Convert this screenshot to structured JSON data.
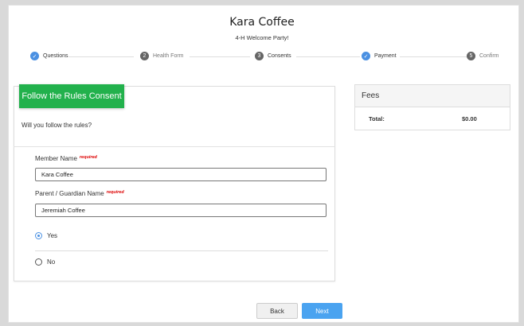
{
  "header": {
    "title": "Kara Coffee",
    "subtitle": "4-H Welcome Party!"
  },
  "steps": [
    {
      "label": "Questions",
      "state": "done",
      "marker": "✓"
    },
    {
      "label": "Health Form",
      "state": "num",
      "marker": "2"
    },
    {
      "label": "Consents",
      "state": "num",
      "marker": "3"
    },
    {
      "label": "Payment",
      "state": "done",
      "marker": "✓"
    },
    {
      "label": "Confirm",
      "state": "num",
      "marker": "5"
    }
  ],
  "consent": {
    "tab_label": "Follow the Rules Consent",
    "question": "Will you follow the rules?",
    "member_label": "Member Name",
    "member_required": "required",
    "member_value": "Kara Coffee",
    "guardian_label": "Parent / Guardian Name",
    "guardian_required": "required",
    "guardian_value": "Jeremiah Coffee",
    "option_yes": "Yes",
    "option_no": "No",
    "selected": "Yes"
  },
  "fees": {
    "heading": "Fees",
    "total_label": "Total:",
    "total_value": "$0.00"
  },
  "buttons": {
    "back": "Back",
    "next": "Next"
  },
  "colors": {
    "accent": "#4a90e2",
    "green": "#22b14c",
    "required": "#dd0000"
  }
}
